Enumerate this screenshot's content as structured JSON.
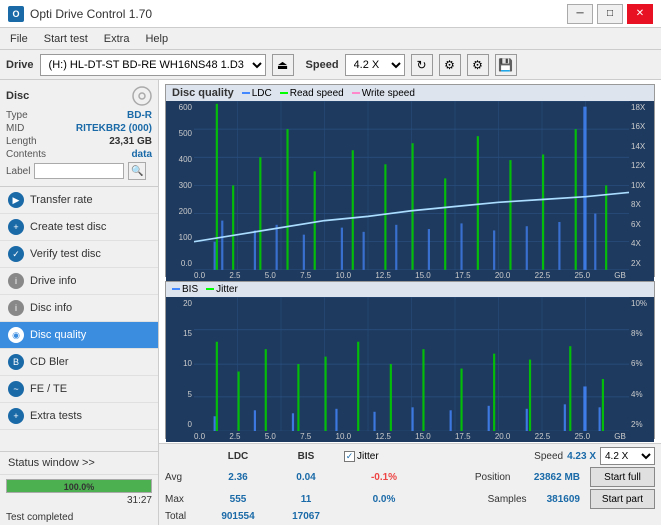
{
  "app": {
    "title": "Opti Drive Control 1.70",
    "icon_label": "O"
  },
  "title_buttons": {
    "minimize": "─",
    "maximize": "□",
    "close": "✕"
  },
  "menu": {
    "items": [
      "File",
      "Start test",
      "Extra",
      "Help"
    ]
  },
  "drive_bar": {
    "label": "Drive",
    "drive_value": "(H:)  HL-DT-ST BD-RE  WH16NS48 1.D3",
    "speed_label": "Speed",
    "speed_value": "4.2 X"
  },
  "disc": {
    "title": "Disc",
    "type_label": "Type",
    "type_value": "BD-R",
    "mid_label": "MID",
    "mid_value": "RITEKBR2 (000)",
    "length_label": "Length",
    "length_value": "23,31 GB",
    "contents_label": "Contents",
    "contents_value": "data",
    "label_label": "Label",
    "label_value": ""
  },
  "nav_items": [
    {
      "id": "transfer-rate",
      "label": "Transfer rate",
      "active": false
    },
    {
      "id": "create-test-disc",
      "label": "Create test disc",
      "active": false
    },
    {
      "id": "verify-test-disc",
      "label": "Verify test disc",
      "active": false
    },
    {
      "id": "drive-info",
      "label": "Drive info",
      "active": false
    },
    {
      "id": "disc-info",
      "label": "Disc info",
      "active": false
    },
    {
      "id": "disc-quality",
      "label": "Disc quality",
      "active": true
    },
    {
      "id": "cd-bler",
      "label": "CD Bler",
      "active": false
    },
    {
      "id": "fe-te",
      "label": "FE / TE",
      "active": false
    },
    {
      "id": "extra-tests",
      "label": "Extra tests",
      "active": false
    }
  ],
  "status_window": {
    "label": "Status window >>",
    "progress_pct": 100,
    "progress_text": "100.0%",
    "time": "31:27",
    "message": "Test completed"
  },
  "chart1": {
    "title": "Disc quality",
    "legends": [
      {
        "id": "ldc",
        "label": "LDC",
        "color": "#4488ff"
      },
      {
        "id": "read-speed",
        "label": "Read speed",
        "color": "#00ee00"
      },
      {
        "id": "write-speed",
        "label": "Write speed",
        "color": "#ff88cc"
      }
    ],
    "y_labels_left": [
      "600",
      "500",
      "400",
      "300",
      "200",
      "100",
      "0.0"
    ],
    "y_labels_right": [
      "18X",
      "16X",
      "14X",
      "12X",
      "10X",
      "8X",
      "6X",
      "4X",
      "2X"
    ],
    "x_labels": [
      "0.0",
      "2.5",
      "5.0",
      "7.5",
      "10.0",
      "12.5",
      "15.0",
      "17.5",
      "20.0",
      "22.5",
      "25.0",
      "GB"
    ]
  },
  "chart2": {
    "legends": [
      {
        "id": "bis",
        "label": "BIS",
        "color": "#4488ff"
      },
      {
        "id": "jitter",
        "label": "Jitter",
        "color": "#00ee00"
      }
    ],
    "y_labels_left": [
      "20",
      "15",
      "10",
      "5",
      "0"
    ],
    "y_labels_right": [
      "10%",
      "8%",
      "6%",
      "4%",
      "2%"
    ],
    "x_labels": [
      "0.0",
      "2.5",
      "5.0",
      "7.5",
      "10.0",
      "12.5",
      "15.0",
      "17.5",
      "20.0",
      "22.5",
      "25.0",
      "GB"
    ]
  },
  "stats": {
    "col_ldc": "LDC",
    "col_bis": "BIS",
    "avg_label": "Avg",
    "avg_ldc": "2.36",
    "avg_bis": "0.04",
    "avg_jitter": "-0.1%",
    "max_label": "Max",
    "max_ldc": "555",
    "max_bis": "11",
    "max_jitter": "0.0%",
    "total_label": "Total",
    "total_ldc": "901554",
    "total_bis": "17067",
    "jitter_label": "Jitter",
    "speed_label": "Speed",
    "speed_value": "4.23 X",
    "position_label": "Position",
    "position_value": "23862 MB",
    "samples_label": "Samples",
    "samples_value": "381609",
    "speed_select": "4.2 X",
    "start_full": "Start full",
    "start_part": "Start part"
  }
}
